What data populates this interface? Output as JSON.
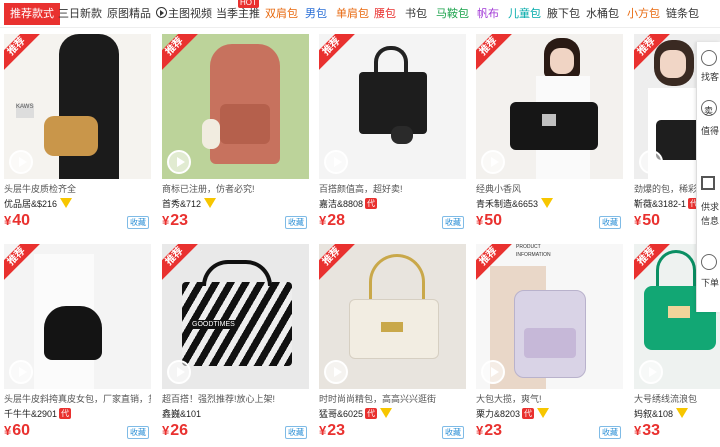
{
  "tabs": [
    {
      "label": "推荐款式",
      "style": "active"
    },
    {
      "label": "三日新款",
      "style": ""
    },
    {
      "label": "原图精品",
      "style": ""
    },
    {
      "label": "主图视频",
      "style": "",
      "icon": "play-icon"
    },
    {
      "label": "当季主推",
      "style": "",
      "hot": "HOT"
    },
    {
      "label": "双肩包",
      "style": "orange"
    },
    {
      "label": "男包",
      "style": "blue"
    },
    {
      "label": "单肩包",
      "style": "orange"
    },
    {
      "label": "腰包",
      "style": "red"
    },
    {
      "label": "书包",
      "style": ""
    },
    {
      "label": "马鞍包",
      "style": "green"
    },
    {
      "label": "帆布",
      "style": "purple"
    },
    {
      "label": "儿童包",
      "style": "teal"
    },
    {
      "label": "腋下包",
      "style": ""
    },
    {
      "label": "水桶包",
      "style": ""
    },
    {
      "label": "小方包",
      "style": "orange"
    },
    {
      "label": "链条包",
      "style": ""
    }
  ],
  "badge_label": "推荐",
  "fav_label": "收藏",
  "currency": "¥",
  "dai_label": "代",
  "products": [
    {
      "desc": "头层牛皮质检齐全",
      "seller": "优品居&$216",
      "vip": true,
      "dai": false,
      "price": "40"
    },
    {
      "desc": "商标已注册，仿者必究!",
      "seller": "首秀&712",
      "vip": true,
      "dai": false,
      "price": "23"
    },
    {
      "desc": "百搭颜值高，超好卖!",
      "seller": "嘉洁&8808",
      "vip": false,
      "dai": true,
      "price": "28"
    },
    {
      "desc": "经典小香风",
      "seller": "青禾制造&6653",
      "vip": true,
      "dai": false,
      "price": "50"
    },
    {
      "desc": "劲爆的包，稀彩的",
      "seller": "靳薇&3182-1",
      "vip": false,
      "dai": true,
      "price": "50"
    },
    {
      "desc": "头层牛皮斜挎真皮女包，厂家直销，货...",
      "seller": "千牛牛&2901",
      "vip": false,
      "dai": true,
      "price": "60"
    },
    {
      "desc": "超百搭！强烈推荐!放心上架!",
      "seller": "鑫巍&101",
      "vip": false,
      "dai": false,
      "price": "26"
    },
    {
      "desc": "时时尚尚精包，高高兴兴逛街",
      "seller": "猛哥&6025",
      "vip": true,
      "dai": true,
      "price": "23"
    },
    {
      "desc": "大包大揽，爽气!",
      "seller": "栗力&8203",
      "vip": true,
      "dai": true,
      "price": "23"
    },
    {
      "desc": "大号绣线流浪包",
      "seller": "妈叙&108",
      "vip": true,
      "dai": false,
      "price": "33"
    }
  ],
  "sidepanel": {
    "items": [
      "找客",
      "卖",
      "值得",
      "供求",
      "信息",
      "下单"
    ]
  },
  "image_text": {
    "p1": "KAWS",
    "p7": "GOODTIMES",
    "p9a": "PRODUCT",
    "p9b": "INFORMATION"
  }
}
